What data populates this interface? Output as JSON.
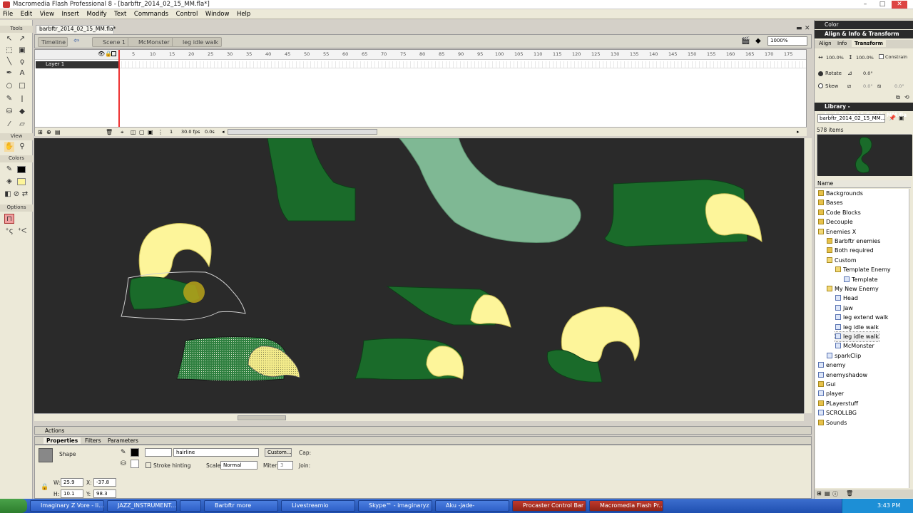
{
  "window": {
    "title": "Macromedia Flash Professional 8 - [barbftr_2014_02_15_MM.fla*]"
  },
  "menu": [
    "File",
    "Edit",
    "View",
    "Insert",
    "Modify",
    "Text",
    "Commands",
    "Control",
    "Window",
    "Help"
  ],
  "tools": {
    "section_tools": "Tools",
    "section_view": "View",
    "section_colors": "Colors",
    "section_options": "Options"
  },
  "doc": {
    "tab": "barbftr_2014_02_15_MM.fla*"
  },
  "scenebar": {
    "timeline": "Timeline",
    "crumbs": [
      "Scene 1",
      "McMonster",
      "leg idle walk"
    ],
    "zoom": "1000%"
  },
  "timeline": {
    "ruler": [
      "5",
      "10",
      "15",
      "20",
      "25",
      "30",
      "35",
      "40",
      "45",
      "50",
      "55",
      "60",
      "65",
      "70",
      "75",
      "80",
      "85",
      "90",
      "95",
      "100",
      "105",
      "110",
      "115",
      "120",
      "125",
      "130",
      "135",
      "140",
      "145",
      "150",
      "155",
      "160",
      "165",
      "170",
      "175"
    ],
    "layer": "Layer 1",
    "frame": "1",
    "fps": "30.0 fps",
    "time": "0.0s"
  },
  "actions": {
    "label": "Actions"
  },
  "properties": {
    "tabs": [
      "Properties",
      "Filters",
      "Parameters"
    ],
    "type": "Shape",
    "stroke_style": "hairline",
    "custom_btn": "Custom...",
    "cap_label": "Cap:",
    "stroke_hinting": "Stroke hinting",
    "scale_label": "Scale:",
    "scale_value": "Normal",
    "miter_label": "Miter:",
    "miter_value": "3",
    "join_label": "Join:",
    "w_label": "W:",
    "w": "25.9",
    "h_label": "H:",
    "h": "10.1",
    "x_label": "X:",
    "x": "-37.8",
    "y_label": "Y:",
    "y": "98.3"
  },
  "right": {
    "color_panel": "Color",
    "align_panel": "Align & Info & Transform",
    "tabs": [
      "Align",
      "Info",
      "Transform"
    ],
    "scale_w": "100.0%",
    "scale_h": "100.0%",
    "constrain": "Constrain",
    "rotate": "Rotate",
    "rotate_val": "0.0°",
    "skew": "Skew",
    "skew_h": "0.0°",
    "skew_v": "0.0°",
    "library_panel": "Library - barbftr_2014_02_15_MM.fla",
    "library_doc": "barbftr_2014_02_15_MM...",
    "item_count": "578 items",
    "name_col": "Name",
    "items": [
      {
        "label": "Backgrounds",
        "kind": "folder",
        "indent": 0
      },
      {
        "label": "Bases",
        "kind": "folder",
        "indent": 0
      },
      {
        "label": "Code Blocks",
        "kind": "folder",
        "indent": 0
      },
      {
        "label": "Decouple",
        "kind": "folder",
        "indent": 0
      },
      {
        "label": "Enemies X",
        "kind": "fopen",
        "indent": 0
      },
      {
        "label": "Barbftr enemies",
        "kind": "folder",
        "indent": 1
      },
      {
        "label": "Both required",
        "kind": "folder",
        "indent": 1
      },
      {
        "label": "Custom",
        "kind": "fopen",
        "indent": 1
      },
      {
        "label": "Template Enemy",
        "kind": "fopen",
        "indent": 2
      },
      {
        "label": "Template",
        "kind": "sym",
        "indent": 3
      },
      {
        "label": "My New Enemy",
        "kind": "fopen",
        "indent": 1
      },
      {
        "label": "Head",
        "kind": "sym",
        "indent": 2
      },
      {
        "label": "Jaw",
        "kind": "sym",
        "indent": 2
      },
      {
        "label": "leg extend walk",
        "kind": "sym",
        "indent": 2
      },
      {
        "label": "leg idle walk",
        "kind": "sym",
        "indent": 2
      },
      {
        "label": "leg idle walk",
        "kind": "sym",
        "indent": 2
      },
      {
        "label": "McMonster",
        "kind": "sym",
        "indent": 2
      },
      {
        "label": "sparkClip",
        "kind": "sym",
        "indent": 1
      },
      {
        "label": "enemy",
        "kind": "sym",
        "indent": 0
      },
      {
        "label": "enemyshadow",
        "kind": "sym",
        "indent": 0
      },
      {
        "label": "Gui",
        "kind": "folder",
        "indent": 0
      },
      {
        "label": "player",
        "kind": "sym",
        "indent": 0
      },
      {
        "label": "PLayerstuff",
        "kind": "folder",
        "indent": 0
      },
      {
        "label": "SCROLLBG",
        "kind": "sym",
        "indent": 0
      },
      {
        "label": "Sounds",
        "kind": "folder",
        "indent": 0
      }
    ]
  },
  "taskbar": {
    "items": [
      "Imaginary Z Vore - li...",
      "JAZZ_INSTRUMENT...",
      "",
      "Barbftr more",
      "Livestreamio",
      "Skype™ - imaginaryz",
      "Aku -jade-",
      "Procaster Control Bar",
      "Macromedia Flash Pr..."
    ],
    "clock": "3:43 PM"
  },
  "colors": {
    "stage": "#2a2a2a",
    "green": "#1a6b2a",
    "claw": "#fdf59a",
    "pale": "#7fb894"
  }
}
